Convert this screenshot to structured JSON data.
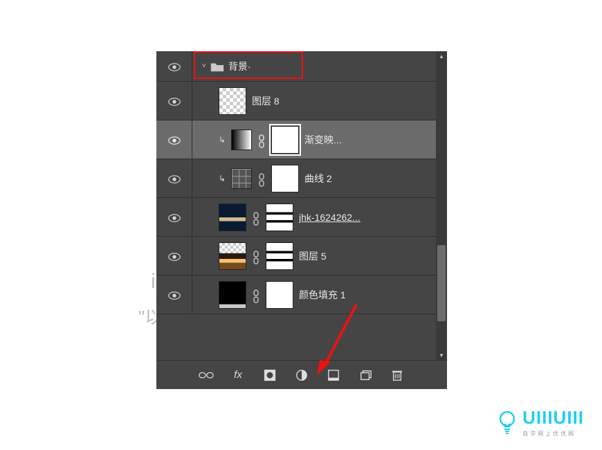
{
  "panel": {
    "group": {
      "name": "背景·"
    },
    "layers": [
      {
        "name": "图层 8"
      },
      {
        "name": "渐变映..."
      },
      {
        "name": "曲线 2"
      },
      {
        "name": "jhk-1624262..."
      },
      {
        "name": "图层 5"
      },
      {
        "name": "颜色填充 1"
      }
    ],
    "toolbar": {
      "link": "link-icon",
      "fx": "fx",
      "mask": "mask-icon",
      "adjust": "adjustment-icon",
      "new_fill": "fill-icon",
      "new_group": "group-icon",
      "trash": "trash-icon"
    }
  },
  "watermark": {
    "line1": "indows",
    "line2": "\"以激活 Windows。"
  },
  "brand": {
    "name": "UIIIUIII",
    "sub": "自学网上优优网"
  }
}
